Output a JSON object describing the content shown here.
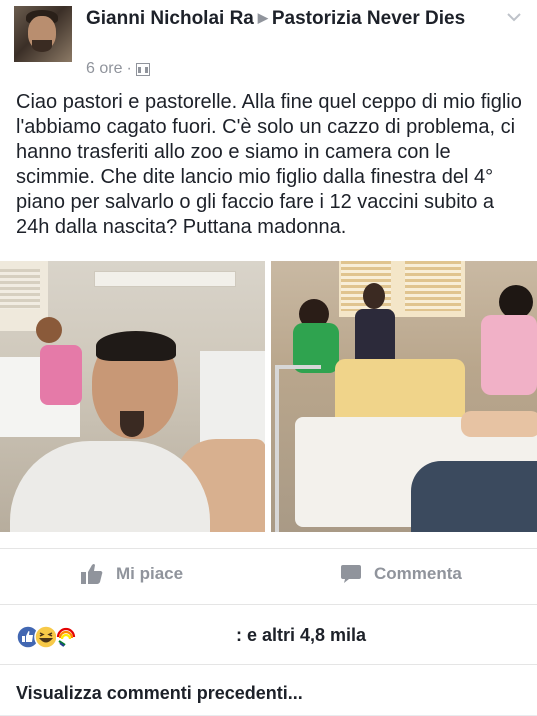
{
  "post": {
    "author": "Gianni Nicholai Ra",
    "group": "Pastorizia Never Dies",
    "time": "6 ore",
    "separator": "·",
    "audience_icon": "group-icon",
    "text": "Ciao pastori e pastorelle. Alla fine quel ceppo di mio figlio l'abbiamo cagato fuori. C'è solo un cazzo di problema, ci hanno trasferiti allo zoo e siamo in camera con le scimmie. Che dite lancio mio figlio dalla finestra del 4° piano per salvarlo o gli faccio fare i 12 vaccini subito a 24h dalla nascita? Puttana madonna."
  },
  "photos": [
    {
      "name": "hospital-selfie-photo"
    },
    {
      "name": "hospital-room-photo"
    }
  ],
  "actions": {
    "like_label": "Mi piace",
    "comment_label": "Commenta"
  },
  "reactions": {
    "icons": [
      "like-icon",
      "haha-icon",
      "pride-icon"
    ],
    "count_text": ": e altri 4,8 mila"
  },
  "comments": {
    "view_previous": "Visualizza commenti precedenti..."
  },
  "colors": {
    "text": "#1d2129",
    "muted": "#90949c",
    "like_blue": "#4267b2",
    "haha_yellow": "#f7c948"
  }
}
